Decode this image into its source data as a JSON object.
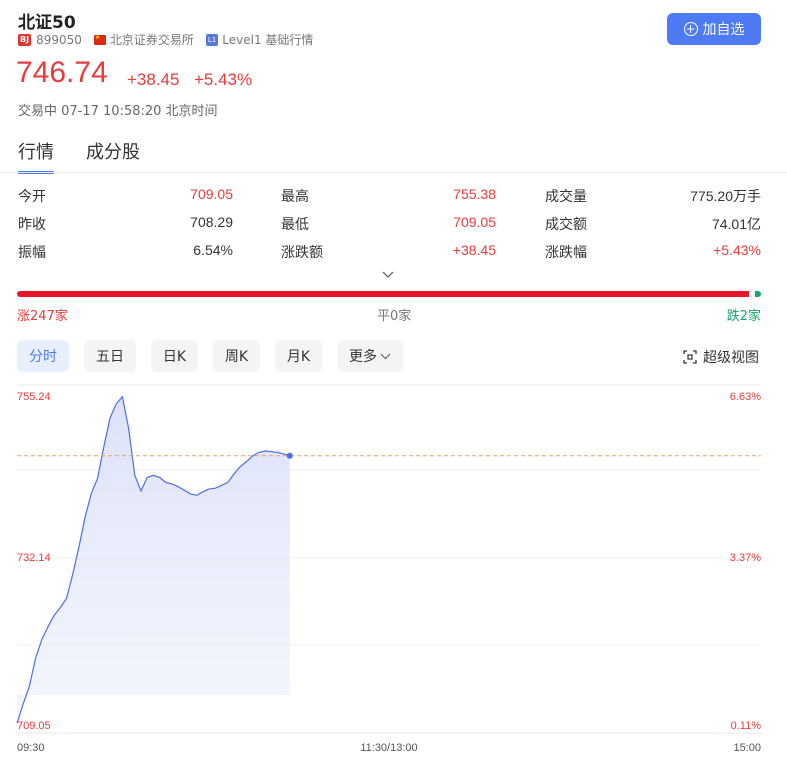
{
  "header": {
    "title": "北证50",
    "exchange_badge": "BJ",
    "code": "899050",
    "exchange_name": "北京证券交易所",
    "level_badge": "L1",
    "level_text": "Level1 基础行情",
    "add_watchlist_label": "加自选"
  },
  "quote": {
    "price": "746.74",
    "change": "+38.45",
    "change_pct": "+5.43%",
    "status": "交易中 07-17 10:58:20 北京时间"
  },
  "tabs": [
    "行情",
    "成分股"
  ],
  "stats": [
    [
      {
        "label": "今开",
        "value": "709.05",
        "tone": "up"
      },
      {
        "label": "最高",
        "value": "755.38",
        "tone": "up"
      },
      {
        "label": "成交量",
        "value": "775.20万手",
        "tone": "neutral"
      }
    ],
    [
      {
        "label": "昨收",
        "value": "708.29",
        "tone": "neutral"
      },
      {
        "label": "最低",
        "value": "709.05",
        "tone": "up"
      },
      {
        "label": "成交额",
        "value": "74.01亿",
        "tone": "neutral"
      }
    ],
    [
      {
        "label": "振幅",
        "value": "6.54%",
        "tone": "neutral"
      },
      {
        "label": "涨跌额",
        "value": "+38.45",
        "tone": "up"
      },
      {
        "label": "涨跌幅",
        "value": "+5.43%",
        "tone": "up"
      }
    ]
  ],
  "breadth": {
    "up_label": "涨247家",
    "flat_label": "平0家",
    "down_label": "跌2家",
    "up_count": 247,
    "flat_count": 0,
    "down_count": 2
  },
  "periods": [
    {
      "label": "分时",
      "active": true
    },
    {
      "label": "五日",
      "active": false
    },
    {
      "label": "日K",
      "active": false
    },
    {
      "label": "周K",
      "active": false
    },
    {
      "label": "月K",
      "active": false
    },
    {
      "label": "更多",
      "active": false
    }
  ],
  "super_view_label": "超级视图",
  "chart_data": {
    "type": "line",
    "y_left_ticks": [
      "755.24",
      "732.14",
      "709.05"
    ],
    "y_right_ticks": [
      "6.63%",
      "3.37%",
      "0.11%"
    ],
    "x_ticks": [
      "09:30",
      "11:30/13:00",
      "15:00"
    ],
    "ylim": [
      709.05,
      755.24
    ],
    "prev_close": 708.29,
    "reference_price": 746.74,
    "total_minutes": 240,
    "session_minutes_elapsed": 88,
    "x": [
      0,
      2,
      4,
      6,
      8,
      10,
      12,
      14,
      16,
      18,
      20,
      22,
      24,
      26,
      28,
      30,
      32,
      34,
      36,
      38,
      40,
      42,
      44,
      46,
      48,
      50,
      52,
      54,
      56,
      58,
      60,
      62,
      64,
      66,
      68,
      70,
      72,
      74,
      76,
      78,
      80,
      82,
      84,
      86,
      88
    ],
    "y": [
      709.3,
      712.0,
      714.5,
      718.4,
      721.0,
      722.8,
      724.4,
      725.5,
      726.8,
      730.2,
      734.0,
      738.2,
      741.5,
      743.6,
      748.0,
      752.0,
      754.0,
      755.0,
      750.6,
      744.0,
      741.8,
      743.7,
      744.0,
      743.7,
      743.0,
      742.8,
      742.4,
      741.9,
      741.4,
      741.2,
      741.7,
      742.1,
      742.2,
      742.6,
      743.0,
      744.2,
      745.2,
      745.9,
      746.7,
      747.2,
      747.4,
      747.3,
      747.2,
      747.0,
      746.74
    ]
  }
}
